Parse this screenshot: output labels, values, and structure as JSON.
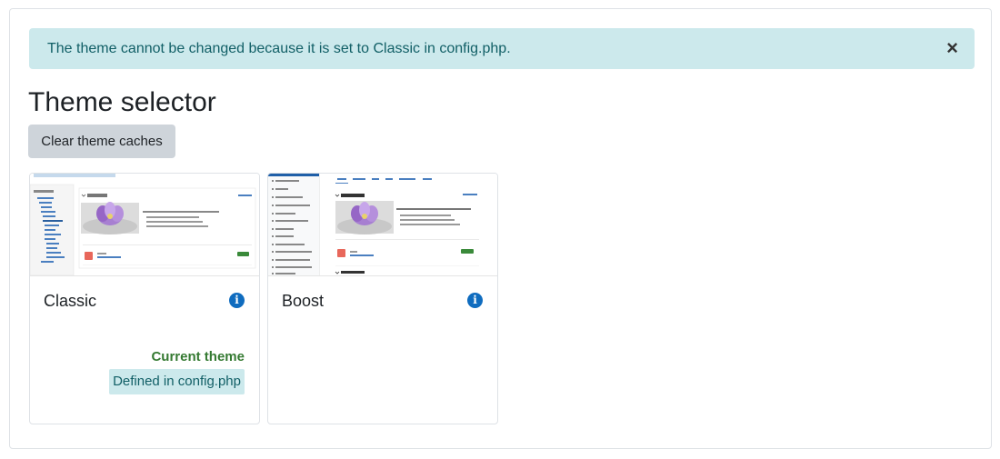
{
  "alert": {
    "message": "The theme cannot be changed because it is set to Classic in config.php.",
    "close_icon": "×"
  },
  "page": {
    "title": "Theme selector",
    "clear_caches_label": "Clear theme caches"
  },
  "themes": [
    {
      "name": "Classic",
      "info_icon": "i",
      "status": "Current theme",
      "defined": "Defined in config.php"
    },
    {
      "name": "Boost",
      "info_icon": "i"
    }
  ],
  "colors": {
    "alert_bg": "#cce9ec",
    "alert_text": "#115f66",
    "info_blue": "#0f6cbf",
    "current_green": "#357a32",
    "button_bg": "#ced4da"
  }
}
